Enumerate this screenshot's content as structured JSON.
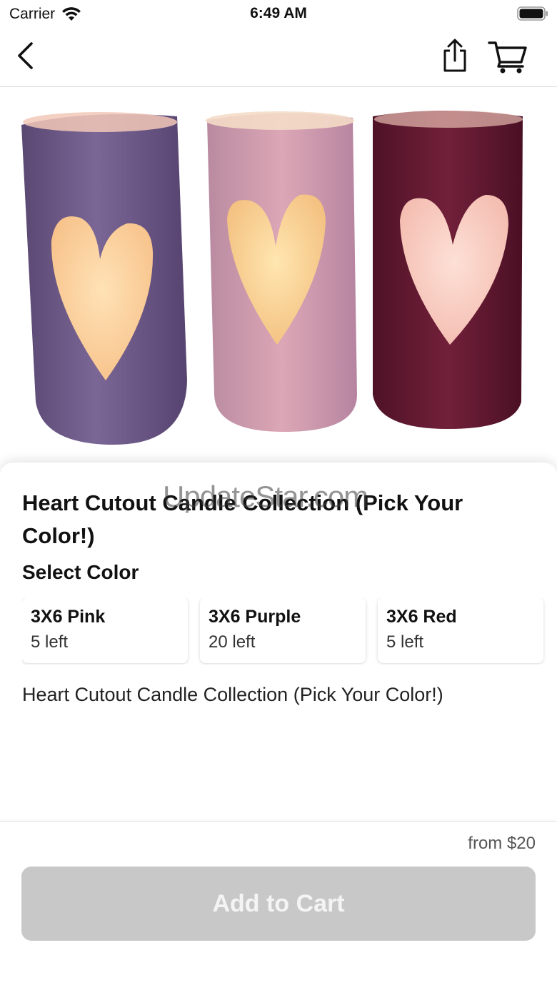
{
  "status_bar": {
    "carrier": "Carrier",
    "time": "6:49 AM"
  },
  "nav": {
    "back_icon": "chevron-left-icon",
    "share_icon": "share-icon",
    "cart_icon": "cart-icon"
  },
  "hero": {
    "candles": [
      {
        "color": "#6f5a86"
      },
      {
        "color": "#c99aaa"
      },
      {
        "color": "#6a1d34"
      }
    ]
  },
  "watermark": "UpdateStar.com",
  "product": {
    "title": "Heart Cutout Candle Collection (Pick Your Color!)",
    "select_label": "Select Color",
    "variants": [
      {
        "name": "3X6 Pink",
        "stock": "5 left"
      },
      {
        "name": "3X6 Purple",
        "stock": "20 left"
      },
      {
        "name": "3X6 Red",
        "stock": "5 left"
      }
    ],
    "description": "Heart Cutout Candle Collection (Pick Your Color!)"
  },
  "footer": {
    "price": "from $20",
    "add_to_cart_label": "Add to Cart",
    "button_color": "#c8c8c8"
  }
}
